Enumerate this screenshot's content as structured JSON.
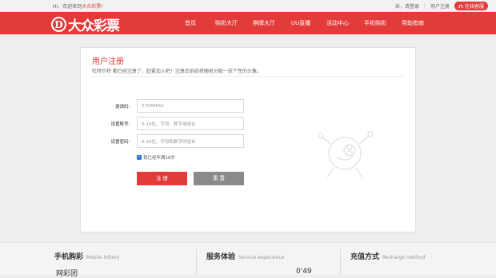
{
  "topbar": {
    "welcome_prefix": "Hi，欢迎来到",
    "welcome_brand": "大众彩票",
    "welcome_suffix": "！",
    "login_prompt": "亲，请登录",
    "separator": "|",
    "register": "用户注册",
    "support": "在线客服"
  },
  "header": {
    "logo_letter": "D",
    "logo_text": "大众彩票",
    "nav": [
      "首页",
      "购彩大厅",
      "棋牌大厅",
      "UU直播",
      "活动中心",
      "手机购彩",
      "帮助指南"
    ]
  },
  "register_card": {
    "title": "用户注册",
    "subtitle": "杜特尔特 都已经注册了，赶紧加入吧！注册后系统将随机分配一张个性的头像。",
    "fields": [
      {
        "label": "邀请码：",
        "value": "57068661"
      },
      {
        "label": "设置账号：",
        "placeholder": "6-16位，字母、数字或组合"
      },
      {
        "label": "设置密码：",
        "placeholder": "6-16位，字母和数字的组合"
      }
    ],
    "agree": "我已经年满18岁",
    "submit": "注 册",
    "reset": "重 置"
  },
  "footer": {
    "sections": [
      {
        "title": "手机购彩",
        "subtitle": "Mobile lottery"
      },
      {
        "title": "服务体验",
        "subtitle": "Service experience"
      },
      {
        "title": "充值方式",
        "subtitle": "Recharge method"
      }
    ],
    "partial_left": "网彩团",
    "partial_mid": "0'49"
  },
  "colors": {
    "accent": "#e33a3a",
    "checkbox": "#2a72d8",
    "reset_button": "#8a8a8a"
  }
}
